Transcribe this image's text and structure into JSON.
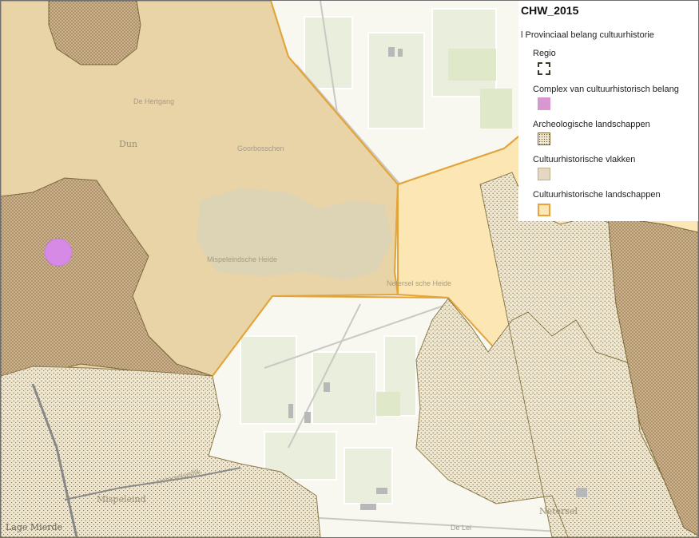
{
  "legend": {
    "title": "CHW_2015",
    "group": "l Provinciaal belang cultuurhistorie",
    "items": [
      {
        "label": "Regio",
        "swatch": "dashed-outline",
        "color": "#3a3a2a"
      },
      {
        "label": "Complex van cultuurhistorisch belang",
        "swatch": "fill",
        "color": "#d898cf"
      },
      {
        "label": "Archeologische landschappen",
        "swatch": "dotted",
        "color": "#7a6a3a"
      },
      {
        "label": "Cultuurhistorische vlakken",
        "swatch": "fill",
        "color": "#e6d7c0"
      },
      {
        "label": "Cultuurhistorische landschappen",
        "swatch": "outline",
        "color": "#e8a33a"
      }
    ]
  },
  "places": {
    "dun": "Dun",
    "de_hertgang": "De Hertgang",
    "goorbosschen": "Goorbosschen",
    "mispeleindsche_heide": "Mispeleindsche Heide",
    "netersele_heide": "Netersel sche Heide",
    "netersel_road": "Neterselsedijk",
    "mispeleind": "Mispeleind",
    "lage_mierde": "Lage Mierde",
    "de_lei": "De Lei",
    "netersel": "Netersel"
  },
  "colors": {
    "tan_area": "#e9d4a8",
    "yellow_area": "#fbe6b4",
    "orange_border": "#e3a43a",
    "complex_circle": "#d68ae6",
    "dotted_area": "#efe5cf"
  }
}
